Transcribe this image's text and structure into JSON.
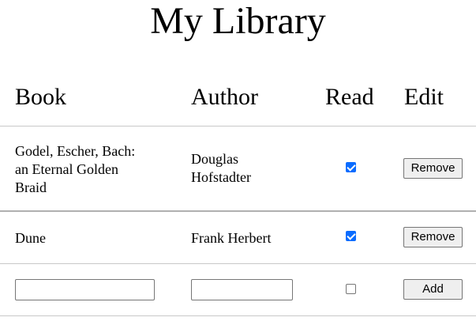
{
  "page": {
    "title": "My Library"
  },
  "table": {
    "headers": {
      "book": "Book",
      "author": "Author",
      "read": "Read",
      "edit": "Edit"
    },
    "rows": [
      {
        "book_lines": [
          "Godel, Escher, Bach:",
          "an Eternal Golden",
          "Braid"
        ],
        "author_lines": [
          "Douglas",
          "Hofstadter"
        ],
        "read": true,
        "action_label": "Remove"
      },
      {
        "book_lines": [
          "Dune"
        ],
        "author_lines": [
          "Frank Herbert"
        ],
        "read": true,
        "action_label": "Remove"
      }
    ],
    "new_entry": {
      "book_value": "",
      "author_value": "",
      "read": false,
      "action_label": "Add"
    }
  }
}
